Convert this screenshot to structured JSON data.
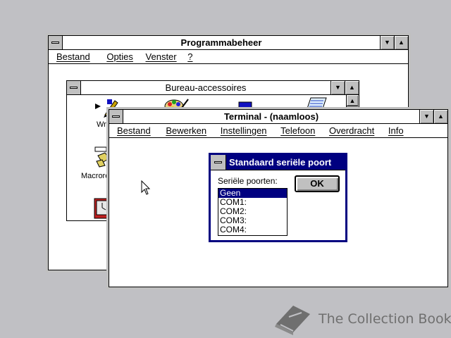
{
  "colors": {
    "desktop": "#c0c0c4",
    "active_title": "#000080",
    "face": "#c0c0c0"
  },
  "program_manager": {
    "title": "Programmabeheer",
    "menu": [
      "Bestand",
      "Opties",
      "Venster",
      "?"
    ]
  },
  "bureau_accessoires": {
    "title": "Bureau-accessoires",
    "icons": [
      {
        "icon": "write-icon",
        "label": "Wri"
      },
      {
        "icon": "paintbrush-icon",
        "label": ""
      },
      {
        "icon": "terminal-icon",
        "label": ""
      },
      {
        "icon": "notepad-icon",
        "label": ""
      },
      {
        "icon": "recorder-icon",
        "label": "Macrore"
      },
      {
        "icon": "clock-icon",
        "label": ""
      }
    ]
  },
  "terminal": {
    "title": "Terminal - (naamloos)",
    "menu": [
      "Bestand",
      "Bewerken",
      "Instellingen",
      "Telefoon",
      "Overdracht",
      "Info"
    ]
  },
  "dialog": {
    "title": "Standaard seriële poort",
    "ports_label": "Seriële poorten:",
    "ok_label": "OK",
    "ports": [
      "Geen",
      "COM1:",
      "COM2:",
      "COM3:",
      "COM4:"
    ],
    "selected_port": "Geen"
  },
  "watermark": {
    "text": "The Collection Book",
    "icon": "book-icon"
  }
}
